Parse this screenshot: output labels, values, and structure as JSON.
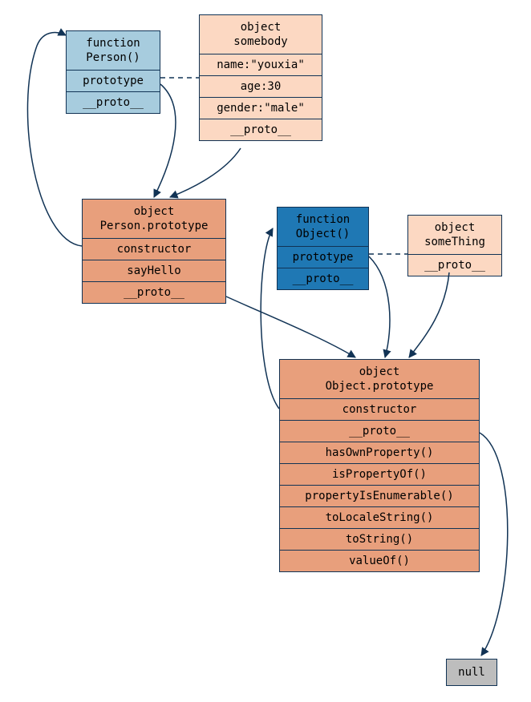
{
  "boxes": {
    "personFn": {
      "header": "function\nPerson()",
      "rows": [
        "prototype",
        "__proto__"
      ]
    },
    "somebody": {
      "header": "object\nsomebody",
      "rows": [
        "name:\"youxia\"",
        "age:30",
        "gender:\"male\"",
        "__proto__"
      ]
    },
    "personProto": {
      "header": "object\nPerson.prototype",
      "rows": [
        "constructor",
        "sayHello",
        "__proto__"
      ]
    },
    "objectFn": {
      "header": "function\nObject()",
      "rows": [
        "prototype",
        "__proto__"
      ]
    },
    "someThing": {
      "header": "object\nsomeThing",
      "rows": [
        "__proto__"
      ]
    },
    "objectProto": {
      "header": "object\nObject.prototype",
      "rows": [
        "constructor",
        "__proto__",
        "hasOwnProperty()",
        "isPropertyOf()",
        "propertyIsEnumerable()",
        "toLocaleString()",
        "toString()",
        "valueOf()"
      ]
    },
    "nullBox": {
      "label": "null"
    }
  }
}
